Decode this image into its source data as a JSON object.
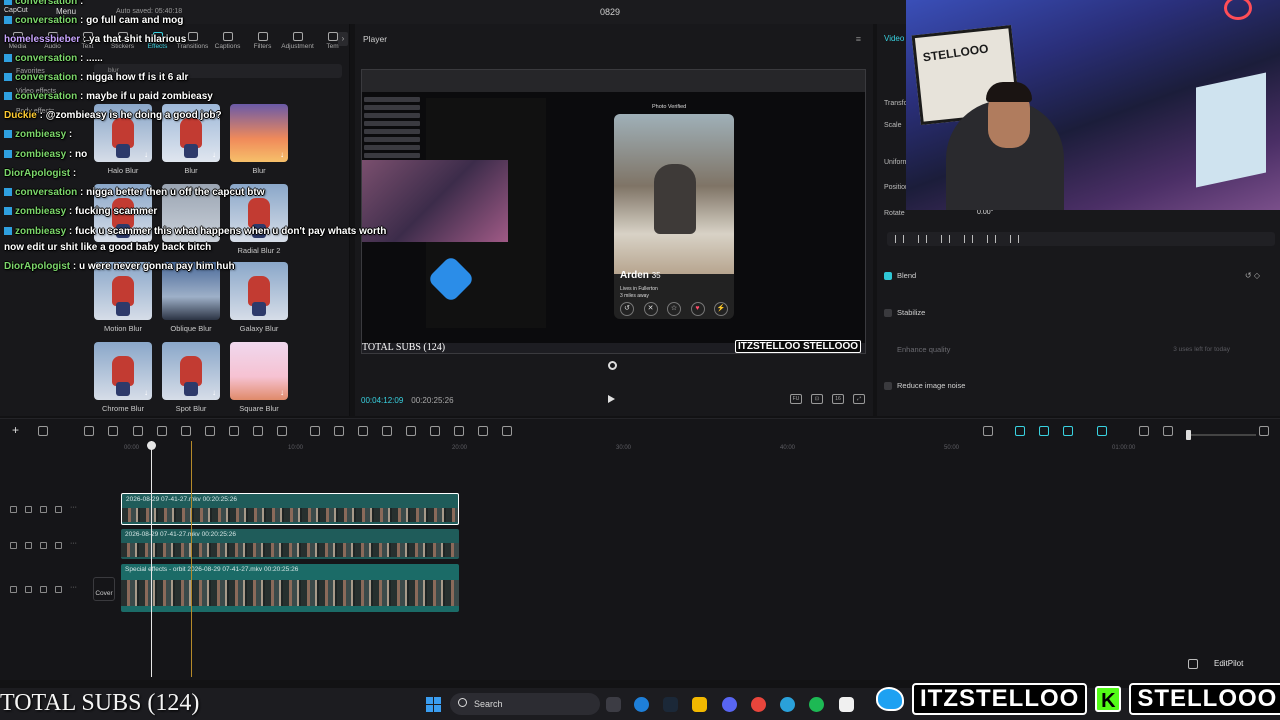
{
  "app": {
    "logo": "CapCut",
    "menu": "Menu",
    "autosave": "Auto saved: 05:40:18",
    "project_title": "0829"
  },
  "media_panel": {
    "tabs": [
      "Media",
      "Audio",
      "Text",
      "Stickers",
      "Effects",
      "Transitions",
      "Captions",
      "Filters",
      "Adjustment",
      "Tem"
    ],
    "active_tab": "Effects",
    "sidebar": [
      "Favorites",
      "Video effects",
      "Body effects"
    ],
    "search_value": "blur",
    "effects": [
      {
        "label": "Halo Blur"
      },
      {
        "label": "Blur"
      },
      {
        "label": "Blur"
      },
      {
        "label": ""
      },
      {
        "label": ""
      },
      {
        "label": "Radial Blur 2"
      },
      {
        "label": "Motion Blur"
      },
      {
        "label": "Oblique Blur"
      },
      {
        "label": "Galaxy Blur"
      },
      {
        "label": "Chrome Blur"
      },
      {
        "label": "Spot Blur"
      },
      {
        "label": "Square Blur"
      }
    ]
  },
  "player": {
    "title": "Player",
    "current_time": "00:04:12:09",
    "total_time": "00:20:25:26",
    "preview": {
      "profile_name": "Arden",
      "profile_age": "35",
      "profile_line1": "Lives in Fullerton",
      "profile_line2": "3 miles away",
      "verified_label": "Photo Verified",
      "subs_text": "TOTAL SUBS (124)",
      "handles": "ITZSTELLOO STELLOOO"
    }
  },
  "inspector": {
    "tab": "Video",
    "rows": [
      "Transform",
      "Scale",
      "Uniform",
      "Position",
      "Rotate"
    ],
    "rotate_value": "0.00°",
    "blend": "Blend",
    "stabilize": "Stabilize",
    "enhance_quality": "Enhance quality",
    "enhance_hint": "3 uses left for today",
    "reduce_noise": "Reduce image noise"
  },
  "webcam": {
    "sign_text": "STELLOOO"
  },
  "chat": [
    {
      "user": "conversation",
      "msg": "",
      "user_color": "green"
    },
    {
      "user": "",
      "msg": "go full cam and mog",
      "user_color": "green"
    },
    {
      "user": "homelessbieber",
      "msg": "ya that shit hilarious",
      "user_color": "purple"
    },
    {
      "user": "conversation",
      "msg": "......",
      "user_color": "green"
    },
    {
      "user": "conversation",
      "msg": "nigga how tf is it 6 alr",
      "user_color": "green"
    },
    {
      "user": "conversation",
      "msg": "maybe if u paid zombieasy",
      "user_color": "green"
    },
    {
      "user": "Duckie",
      "msg": "@zombieasy is he doing a good job?",
      "user_color": "green"
    },
    {
      "user": "zombieasy",
      "msg": "",
      "user_color": "green"
    },
    {
      "user": "zombieasy",
      "msg": "no",
      "user_color": "green"
    },
    {
      "user": "DiorApologist",
      "msg": "",
      "user_color": "green"
    },
    {
      "user": "conversation",
      "msg": "nigga better then u off the capcut btw",
      "user_color": "green"
    },
    {
      "user": "zombieasy",
      "msg": "fucking scammer",
      "user_color": "green"
    },
    {
      "user": "zombieasy",
      "msg": "fuck u scammer this what happens when u don't pay whats worth",
      "user_color": "green"
    },
    {
      "user": "",
      "msg": "now edit ur shit like a good baby back bitch",
      "user_color": "green"
    },
    {
      "user": "DiorApologist",
      "msg": "u were never gonna pay him huh",
      "user_color": "green"
    }
  ],
  "timeline": {
    "ruler": [
      "00:00",
      "10:00",
      "20:00",
      "30:00",
      "40:00",
      "50:00",
      "01:00:00"
    ],
    "clips": [
      {
        "label": "2026-08-29 07-41-27.mkv   00:20:25:26"
      },
      {
        "label": "2026-08-29 07-41-27.mkv   00:20:25:26"
      },
      {
        "label": "Special effects - orbit   2026-08-29 07-41-27.mkv   00:20:25:26"
      }
    ],
    "cover_label": "Cover",
    "assistant": "EditPilot"
  },
  "taskbar": {
    "search_label": "Search"
  },
  "overlay": {
    "subs_text": "TOTAL SUBS (124)",
    "twitter_handle": "ITZSTELLOO",
    "kick_handle": "STELLOOO",
    "kick_letter": "K"
  },
  "colors": {
    "accent": "#39d2e0",
    "chat_user": "#7cd66b",
    "clip": "#1f5c5a"
  }
}
